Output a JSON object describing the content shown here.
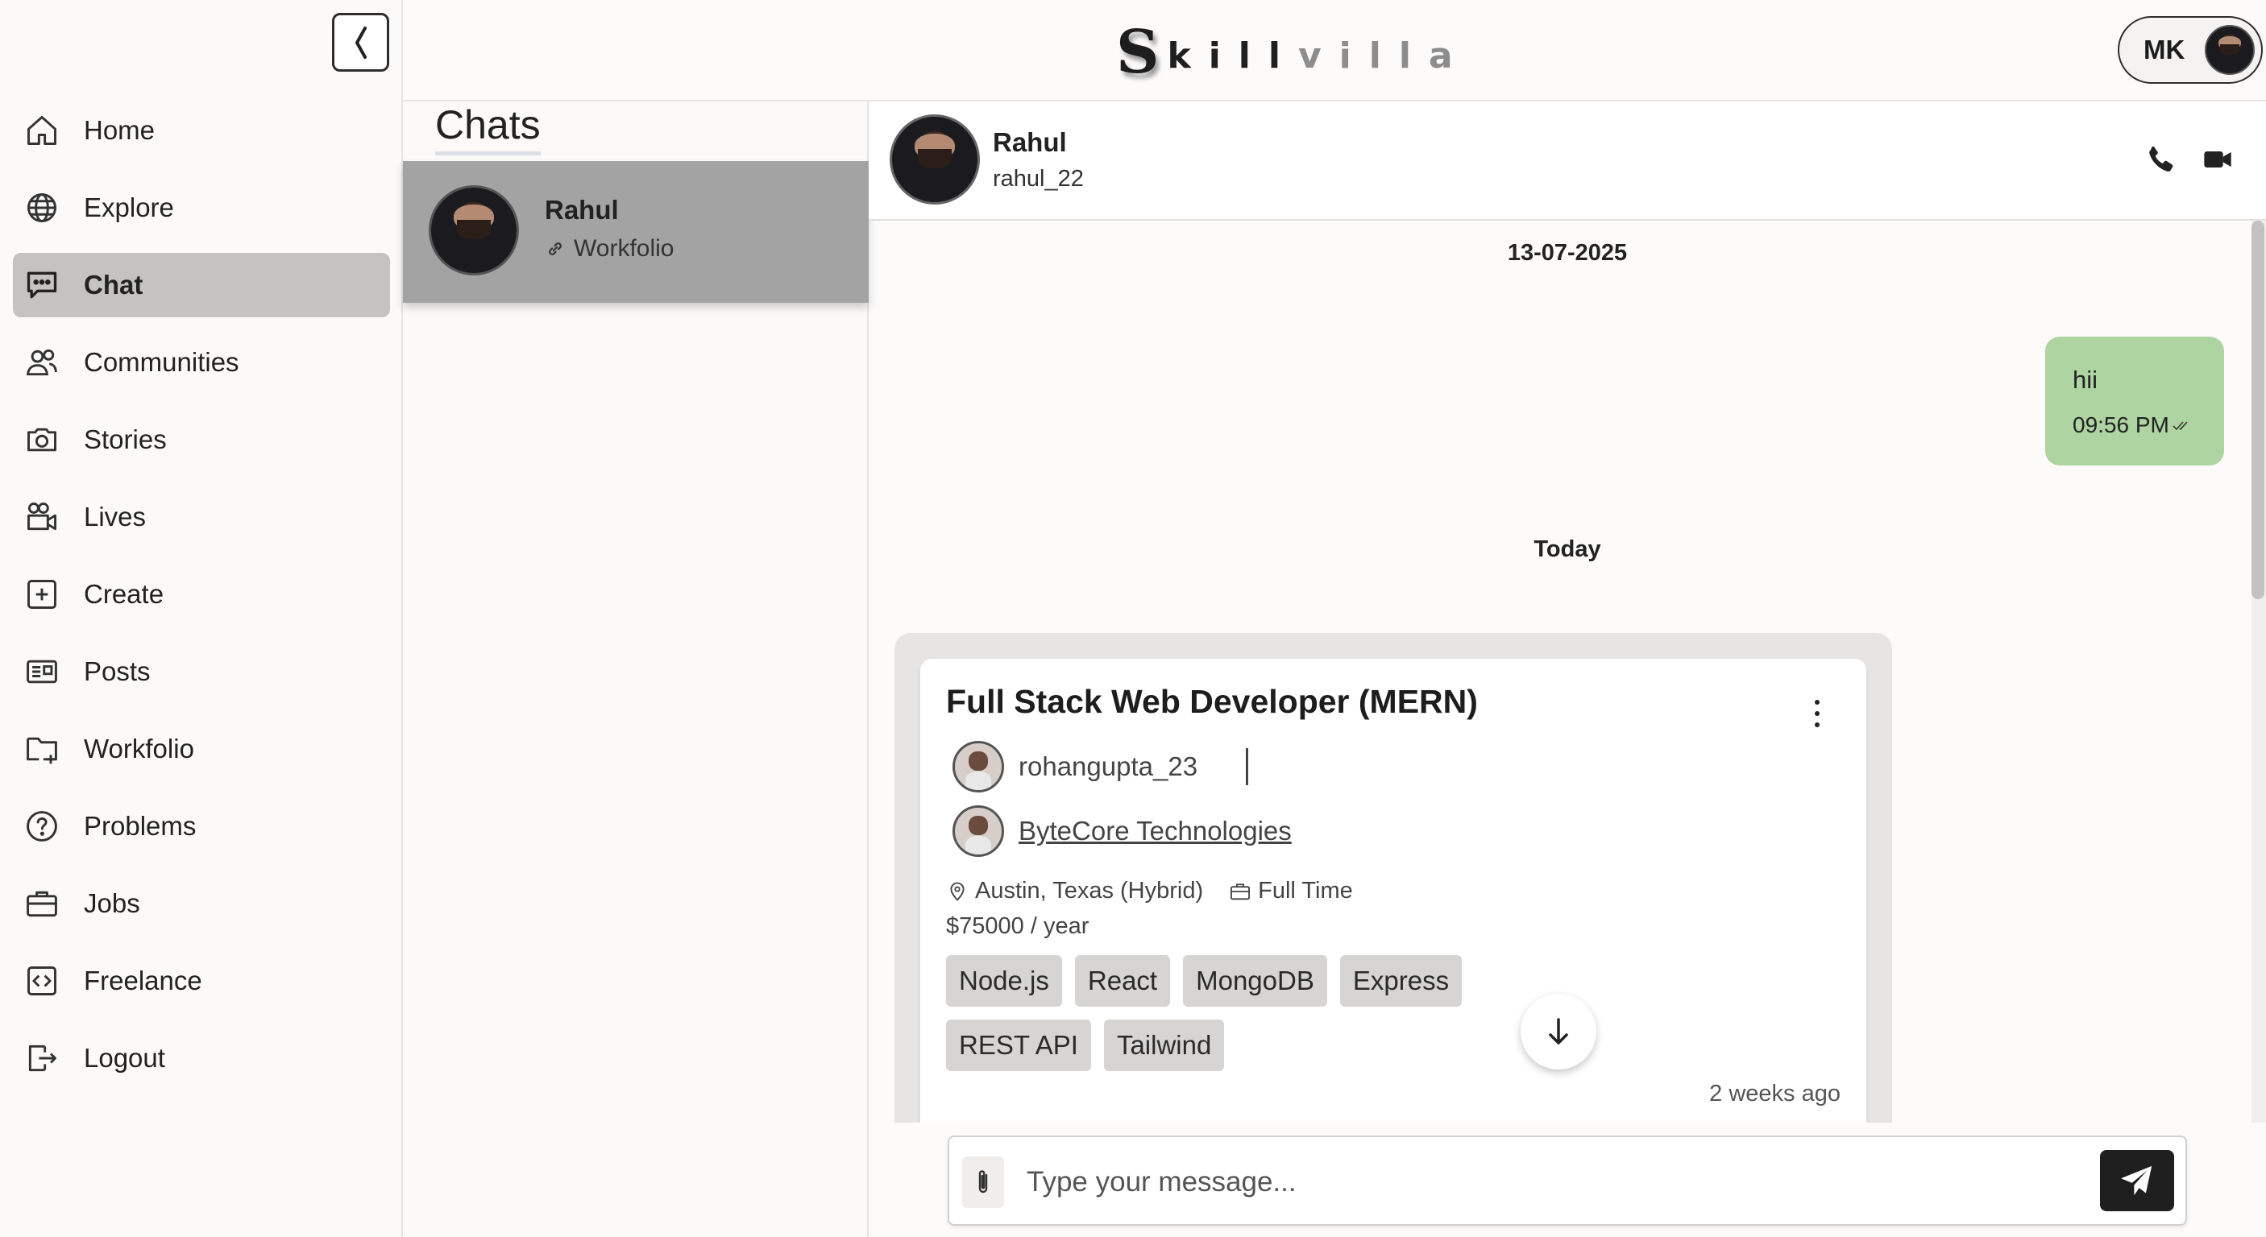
{
  "app": {
    "brand_first": "S",
    "brand_dark": "kill",
    "brand_light": "villa"
  },
  "sidebar": {
    "collapse_icon": "chevron-left-icon",
    "items": [
      {
        "label": "Home",
        "icon": "home-icon",
        "active": false
      },
      {
        "label": "Explore",
        "icon": "globe-icon",
        "active": false
      },
      {
        "label": "Chat",
        "icon": "chat-icon",
        "active": true
      },
      {
        "label": "Communities",
        "icon": "users-icon",
        "active": false
      },
      {
        "label": "Stories",
        "icon": "camera-icon",
        "active": false
      },
      {
        "label": "Lives",
        "icon": "video-camera-icon",
        "active": false
      },
      {
        "label": "Create",
        "icon": "plus-square-icon",
        "active": false
      },
      {
        "label": "Posts",
        "icon": "newspaper-icon",
        "active": false
      },
      {
        "label": "Workfolio",
        "icon": "folder-plus-icon",
        "active": false
      },
      {
        "label": "Problems",
        "icon": "question-circle-icon",
        "active": false
      },
      {
        "label": "Jobs",
        "icon": "briefcase-icon",
        "active": false
      },
      {
        "label": "Freelance",
        "icon": "code-square-icon",
        "active": false
      },
      {
        "label": "Logout",
        "icon": "logout-icon",
        "active": false
      }
    ]
  },
  "header": {
    "profile_initials": "MK"
  },
  "chats": {
    "title": "Chats",
    "list": [
      {
        "name": "Rahul",
        "sub": "Workfolio",
        "sub_icon": "link-icon"
      }
    ]
  },
  "conversation": {
    "name": "Rahul",
    "handle": "rahul_22",
    "date1": "13-07-2025",
    "outgoing": {
      "text": "hii",
      "time": "09:56 PM"
    },
    "date2": "Today",
    "job": {
      "title": "Full Stack Web Developer (MERN)",
      "poster": "rohangupta_23",
      "company": "ByteCore Technologies",
      "location": "Austin, Texas (Hybrid)",
      "type": "Full Time",
      "salary": "$75000 / year",
      "tags": [
        "Node.js",
        "React",
        "MongoDB",
        "Express",
        "REST API",
        "Tailwind"
      ],
      "posted": "2 weeks ago"
    }
  },
  "composer": {
    "placeholder": "Type your message...",
    "value": ""
  },
  "colors": {
    "active_nav": "#c5c3c1",
    "outgoing_bubble": "#aed4a1",
    "selected_chat": "#a3a3a3",
    "send_button": "#1f1f1f"
  }
}
